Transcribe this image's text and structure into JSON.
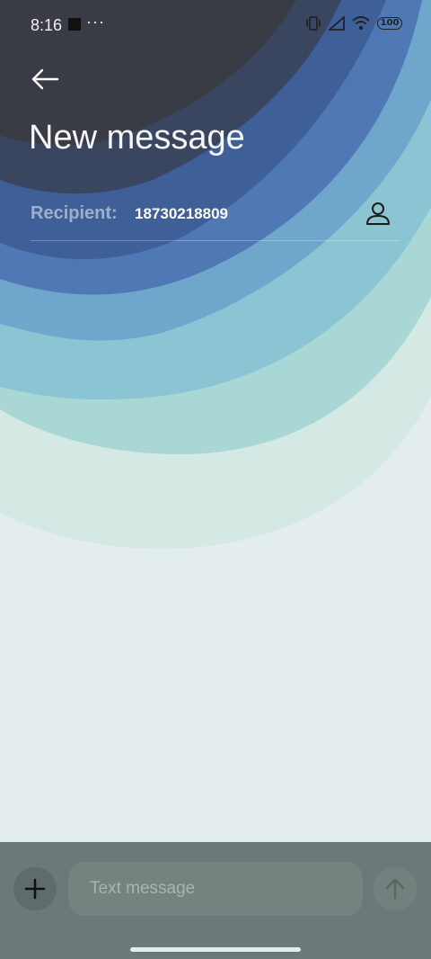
{
  "status_bar": {
    "time": "8:16",
    "dots": "···",
    "battery": "100"
  },
  "header": {
    "title": "New message",
    "back_icon": "arrow-left-icon"
  },
  "recipient": {
    "label": "Recipient:",
    "value": "18730218809",
    "contact_icon": "person-icon"
  },
  "composer": {
    "placeholder": "Text message",
    "add_icon": "plus-icon",
    "send_icon": "arrow-up-icon"
  },
  "colors": {
    "title": "#f4f6f8",
    "compose_bar": "#6b7978",
    "background": "#e3ecee"
  }
}
